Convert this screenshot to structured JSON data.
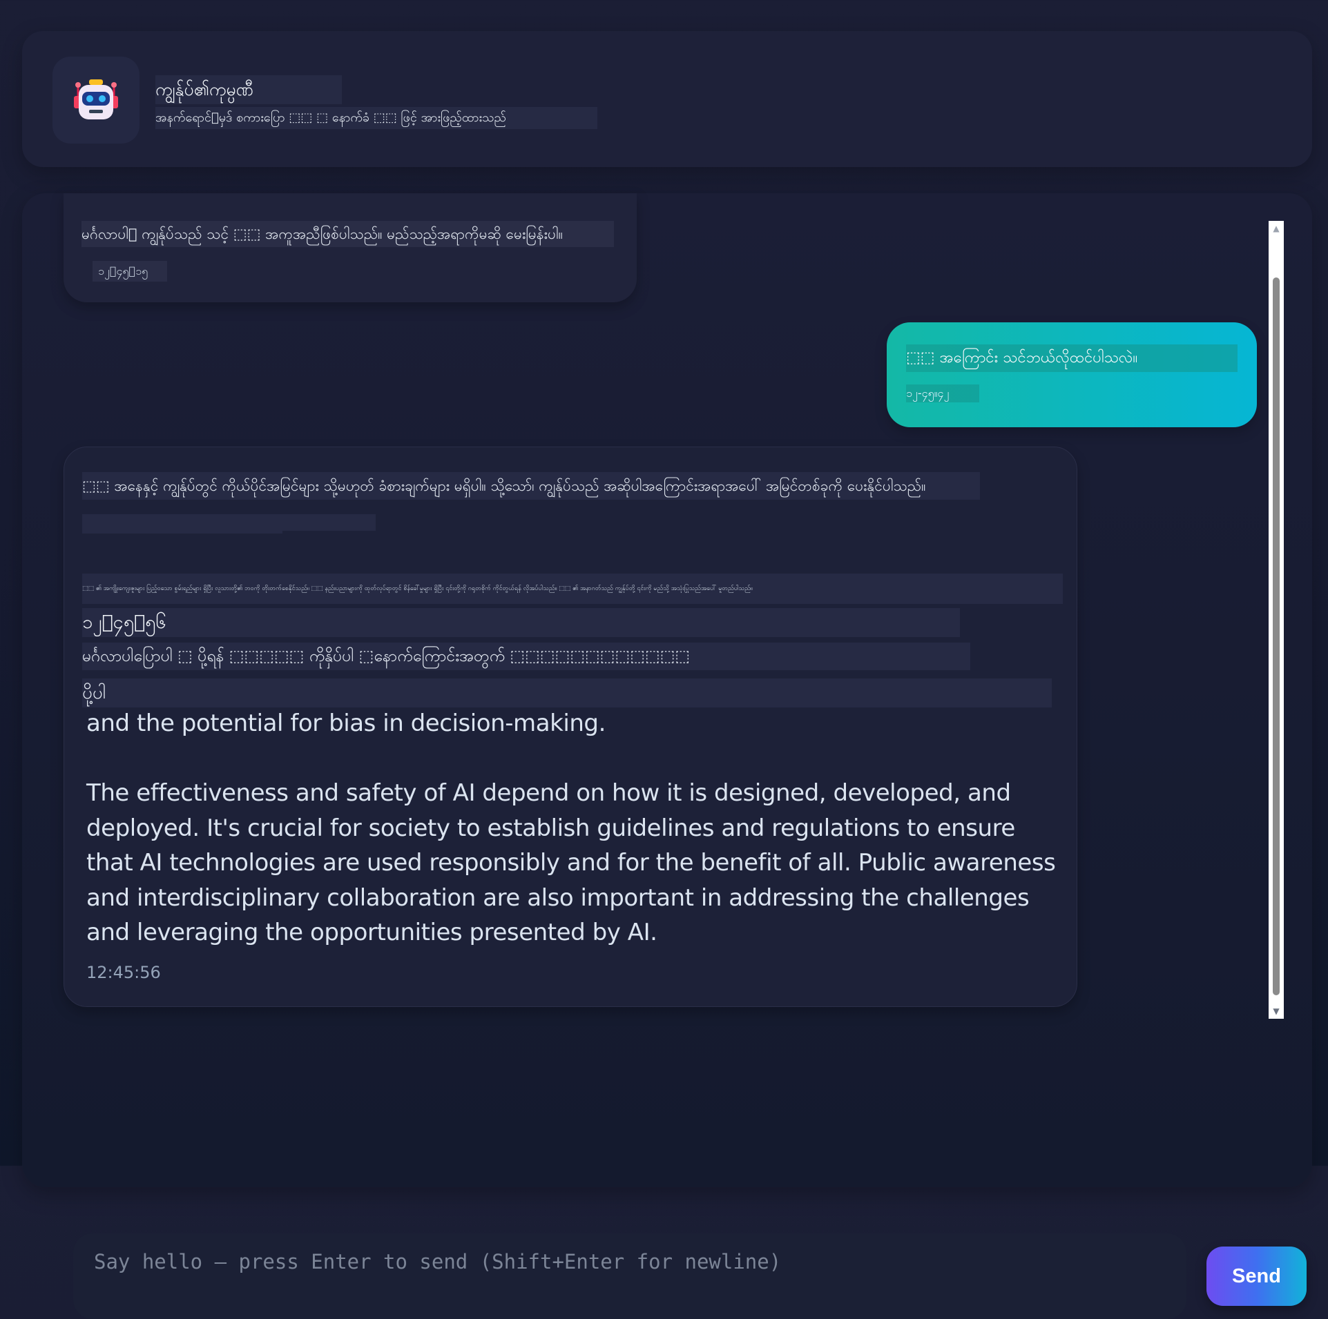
{
  "header": {
    "title": "ကျွန်ုပ်၏ကုမ္ပဏီ",
    "subtitle": "အနက်ရောင်􀀀မှဒ် စကားပြော ⬚⬚ ⬚ နောက်ခံ ⬚⬚ ဖြင့် အားဖြည့်ထားသည်",
    "avatar_icon": "robot-icon"
  },
  "messages": {
    "bot1": {
      "text": "မင်္ဂလာပါ􀀀 ကျွန်ုပ်သည် သင့် ⬚⬚ အကူအညီဖြစ်ပါသည်။ မည်သည့်အရာကိုမဆို မေးမြန်းပါ။",
      "time": "၁၂􀀀၄၅􀀀၁၅"
    },
    "user1": {
      "text": "⬚⬚ အကြောင်း သင်ဘယ်လိုထင်ပါသလဲ။",
      "time": "၁၂-၄၅။၄၂"
    },
    "bot2": {
      "line1": "⬚⬚ အနေနှင့် ကျွန်ုပ်တွင် ကိုယ်ပိုင်အမြင်များ သို့မဟုတ် ခံစားချက်များ မရှိပါ။ သို့သော်၊ ကျွန်ုပ်သည် အဆိုပါအကြောင်းအရာအပေါ် အမြင်တစ်ခုကို ပေးနိုင်ပါသည်။",
      "tiny": "⬚⬚ ၏ အကျိုးကျေးဇူးများ ပြည့်ဝသော စွမ်းရည်များ ရှိပြီး လူသားတို့၏ ဘဝကို တိုးတက်စေနိုင်သည်။ ⬚⬚ နည်းပညာများကို ထုတ်လုပ်ရာတွင် စိန်ခေါ်မှုများ ရှိပြီး ၎င်းတို့ကို ဂရုတစိုက် ကိုင်တွယ်ရန် လိုအပ်ပါသည်။ ⬚⬚ ၏ အနာဂတ်သည် ကျွန်ုပ်တို့ ၎င်းကို မည်သို့ အသုံးပြုသည်အပေါ် မူတည်ပါသည်။",
      "timestamp": "၁၂􀀀၄၅􀀀၅၆",
      "greeting": "မင်္ဂလာပါပြောပါ ⬚ ပို့ရန် ⬚⬚⬚⬚⬚ ကိုနှိပ်ပါ ⬚နောက်ကြောင်းအတွက် ⬚⬚⬚⬚⬚⬚⬚⬚⬚⬚⬚⬚",
      "send_word": "ပို့ပါ",
      "para1": "and the potential for bias in decision-making.",
      "para2": "The effectiveness and safety of AI depend on how it is designed, developed, and deployed. It's crucial for society to establish guidelines and regulations to ensure that AI technologies are used responsibly and for the benefit of all. Public awareness and interdisciplinary collaboration are also important in addressing the challenges and leveraging the opportunities presented by AI.",
      "time": "12:45:56"
    }
  },
  "scrollbar": {
    "up_arrow": "▲",
    "down_arrow": "▼"
  },
  "composer": {
    "placeholder": "Say hello — press Enter to send (Shift+Enter for newline)",
    "send_label": "Send"
  },
  "colors": {
    "background": "#181b33",
    "panel": "#1e2139",
    "user_bubble_start": "#14b8a6",
    "user_bubble_end": "#06b6d4",
    "send_gradient_start": "#6d4df0",
    "send_gradient_end": "#12b3d9"
  }
}
